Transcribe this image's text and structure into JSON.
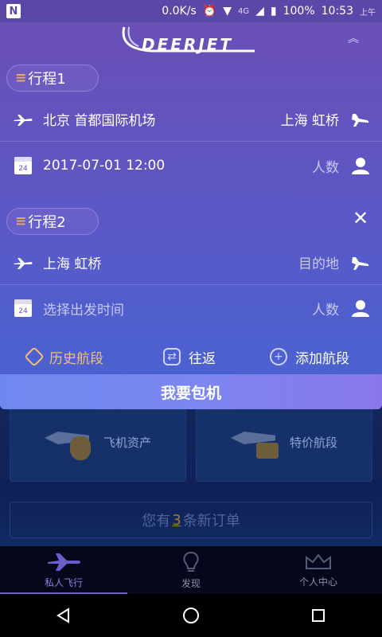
{
  "status_bar": {
    "speed": "0.0K/s",
    "network": "4G",
    "battery": "100%",
    "time": "10:53",
    "ampm": "上午"
  },
  "header": {
    "logo_text": "DEERJET"
  },
  "trips": [
    {
      "label": "行程1",
      "origin": "北京 首都国际机场",
      "destination": "上海 虹桥",
      "datetime": "2017-07-01 12:00",
      "passengers": "人数"
    },
    {
      "label": "行程2",
      "origin": "上海 虹桥",
      "destination": "目的地",
      "datetime": "选择出发时间",
      "passengers": "人数"
    }
  ],
  "calendar_day": "24",
  "actions": {
    "history": "历史航段",
    "round_trip": "往返",
    "add_segment": "添加航段"
  },
  "charter_button": "我要包机",
  "cards": {
    "assets": "飞机资产",
    "special": "特价航段"
  },
  "orders": {
    "prefix": "您有",
    "count": "3",
    "suffix": "条新订单"
  },
  "tabs": [
    {
      "label": "私人飞行",
      "active": true
    },
    {
      "label": "发现",
      "active": false
    },
    {
      "label": "个人中心",
      "active": false
    }
  ],
  "colors": {
    "accent": "#f0c070",
    "panel_top": "#6a4fb6",
    "panel_bottom": "#4a63d2",
    "charter": "#7b86f0"
  }
}
